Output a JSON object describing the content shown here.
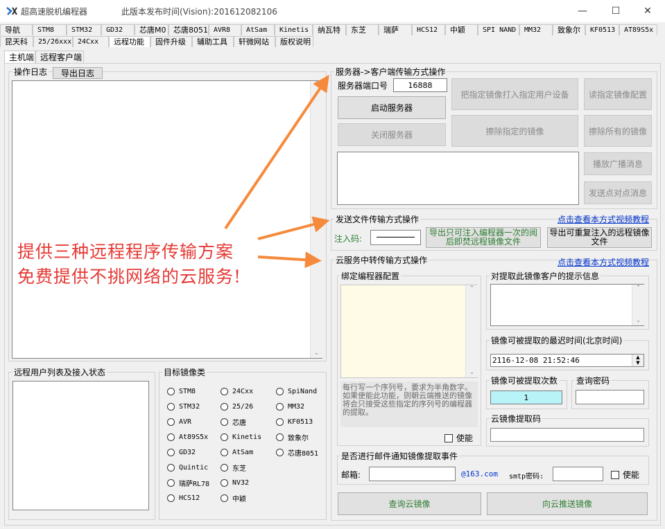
{
  "window": {
    "title": "超高速脱机编程器",
    "version": "此版本发布时间(Vision):201612082106",
    "minimize": "—",
    "maximize": "☐",
    "close": "✕"
  },
  "tabs_row1": [
    "导航",
    "STM8",
    "STM32",
    "GD32",
    "芯唐M0",
    "芯唐8051",
    "AVR8",
    "AtSam",
    "Kinetis",
    "纳瓦特",
    "东芝",
    "瑞萨",
    "HCS12",
    "中颖",
    "SPI NAND",
    "MM32",
    "致象尔",
    "KF0513",
    "AT89S5x"
  ],
  "tabs_row2": [
    "昆天科",
    "25/26xxx",
    "24Cxx",
    "远程功能",
    "固件升级",
    "辅助工具",
    "轩微网站",
    "版权说明"
  ],
  "subtabs": [
    "主机端",
    "远程客户端"
  ],
  "log": {
    "legend": "操作日志",
    "export_button": "导出日志"
  },
  "remote_users": {
    "legend": "远程用户列表及接入状态"
  },
  "target_images": {
    "legend": "目标镜像类",
    "col1": [
      "STM8",
      "STM32",
      "AVR",
      "At89S5x",
      "GD32",
      "Quintic",
      "瑞萨RL78",
      "HCS12"
    ],
    "col2": [
      "24Cxx",
      "25/26",
      "芯唐",
      "Kinetis",
      "AtSam",
      "东芝",
      "NV32",
      "中颖"
    ],
    "col3": [
      "SpiNand",
      "MM32",
      "KF0513",
      "致象尔",
      "芯唐8051"
    ]
  },
  "server": {
    "legend": "服务器->客户端传输方式操作",
    "port_label": "服务器端口号",
    "port_value": "16888",
    "start_button": "启动服务器",
    "stop_button": "关闭服务器",
    "push_image_button": "把指定镜像打入指定用户设备",
    "read_config_button": "读指定镜像配置",
    "erase_image_button": "擦除指定的镜像",
    "erase_all_button": "擦除所有的镜像",
    "broadcast_button": "播放广播消息",
    "p2p_button": "发送点对点消息"
  },
  "file_send": {
    "legend": "发送文件传输方式操作",
    "video_link": "点击查看本方式视频教程",
    "inject_label": "注入码:",
    "export_once_button": "导出只可注入编程器一次的阅后即焚远程镜像文件",
    "export_repeat_button": "导出可重复注入的远程镜像文件"
  },
  "cloud": {
    "legend": "云服务中转传输方式操作",
    "video_link": "点击查看本方式视频教程",
    "bind_legend": "绑定编程器配置",
    "serial_hint": "每行写一个序列号，要求为半角数字。如果使能此功能，则朝云端推送的镜像将会只接受这些指定的序列号的编程器的提取。",
    "enable_label": "使能",
    "client_hint_legend": "对提取此镜像客户的提示信息",
    "latest_time_legend": "镜像可被提取的最迟时间(北京时间)",
    "latest_time_value": "2116-12-08 21:52:46",
    "count_legend": "镜像可被提取次数",
    "count_value": "1",
    "query_pwd_legend": "查询密码",
    "extract_code_legend": "云镜像提取码",
    "email_legend": "是否进行邮件通知镜像提取事件",
    "email_label": "邮箱:",
    "email_domain": "@163.com",
    "smtp_label": "smtp密码:",
    "email_enable_label": "使能",
    "query_button": "查询云镜像",
    "push_button": "向云推送镜像"
  },
  "annotation": {
    "line1": "提供三种远程程序传输方案",
    "line2": "免费提供不挑网络的云服务!"
  },
  "colors": {
    "arrow": "#f58a3c",
    "overlay_text": "#e53935",
    "link": "#0033cc",
    "green_text": "#2e7d32"
  }
}
